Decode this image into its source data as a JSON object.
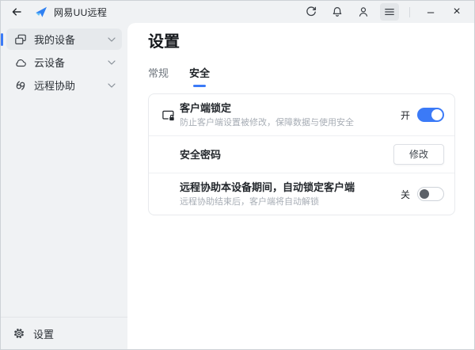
{
  "titlebar": {
    "app_title": "网易UU远程",
    "back_icon": "back-arrow-icon",
    "logo_icon": "uu-logo-icon",
    "action_icons": [
      "refresh-icon",
      "notification-bell-icon",
      "user-icon",
      "menu-icon"
    ],
    "minimize_glyph": "–",
    "close_glyph": "×"
  },
  "sidebar": {
    "items": [
      {
        "label": "我的设备",
        "icon": "devices-icon",
        "selected": true
      },
      {
        "label": "云设备",
        "icon": "cloud-icon",
        "selected": false
      },
      {
        "label": "远程协助",
        "icon": "remote-assist-icon",
        "selected": false
      }
    ],
    "footer": {
      "label": "设置",
      "icon": "gear-icon"
    }
  },
  "main": {
    "page_title": "设置",
    "tabs": [
      {
        "label": "常规",
        "active": false
      },
      {
        "label": "安全",
        "active": true
      }
    ],
    "settings": [
      {
        "icon": "client-lock-icon",
        "title": "客户端锁定",
        "subtitle": "防止客户端设置被修改，保障数据与使用安全",
        "control": "toggle",
        "state_label": "开",
        "enabled": true
      },
      {
        "title": "安全密码",
        "control": "button",
        "button_label": "修改"
      },
      {
        "title": "远程协助本设备期间，自动锁定客户端",
        "subtitle": "远程协助结束后，客户端将自动解锁",
        "control": "toggle",
        "state_label": "关",
        "enabled": false
      }
    ]
  },
  "colors": {
    "accent_blue": "#3b7af7",
    "titlebar_sidebar_bg": "#f0f2f4",
    "panel_bg": "#ffffff",
    "toggle_off_knob": "#5c6168"
  }
}
